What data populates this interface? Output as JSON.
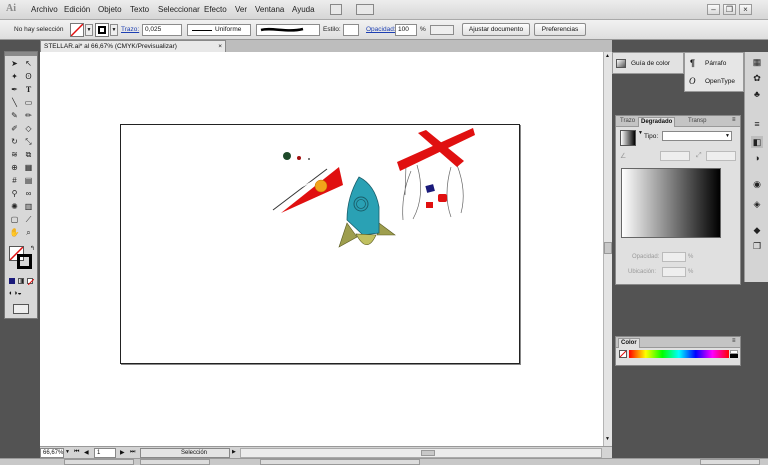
{
  "app": {
    "logo_text": "Ai"
  },
  "menu": [
    "Archivo",
    "Edición",
    "Objeto",
    "Texto",
    "Seleccionar",
    "Efecto",
    "Ver",
    "Ventana",
    "Ayuda"
  ],
  "window_controls": {
    "minimize": "–",
    "restore": "❐",
    "close": "×"
  },
  "control_bar": {
    "selection_state": "No hay selección",
    "stroke_label": "Trazo:",
    "stroke_value": "0,025",
    "profile_value": "Uniforme",
    "style_label": "Estilo:",
    "opacity_label": "Opacidad:",
    "opacity_value": "100",
    "percent": "%",
    "fit_button": "Ajustar documento",
    "prefs_button": "Preferencias"
  },
  "document": {
    "tab_title": "STELLAR.ai* al 66,67% (CMYK/Previsualizar)",
    "close": "×"
  },
  "status_bar": {
    "zoom": "66,67%",
    "page": "1",
    "tool": "Selección"
  },
  "panels": {
    "color_guide": "Guía de color",
    "paragraph": "Párrafo",
    "opentype": "OpenType",
    "gradient": {
      "tab_stroke": "Trazo",
      "tab_gradient": "Degradado",
      "tab_transparency": "Transp",
      "type_label": "Tipo:",
      "opacity_label": "Opacidad:",
      "location_label": "Ubicación:",
      "percent": "%"
    },
    "color": {
      "tab": "Color"
    }
  },
  "colors": {
    "accent_red": "#e01010",
    "rocket_teal": "#2aa1b4",
    "rocket_olive": "#9e9e4e",
    "navy": "#1a1a7a",
    "dark_green": "#1e4a2a"
  }
}
